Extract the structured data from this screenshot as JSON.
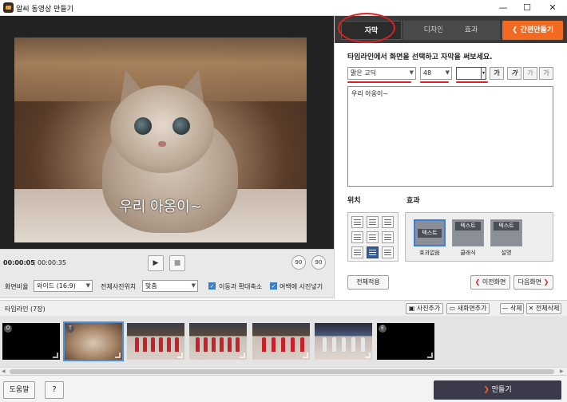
{
  "window": {
    "title": "알씨 동영상 만들기",
    "minimize": "—",
    "maximize": "☐",
    "close": "✕"
  },
  "video": {
    "caption": "우리 아옹이~"
  },
  "controls": {
    "current_time": "00:00:05",
    "total_time": "00:00:35",
    "play": "▶",
    "stop": "■",
    "rotate_left": "90",
    "rotate_right": "90"
  },
  "options": {
    "aspect_label": "화면비율",
    "aspect_value": "와이드 (16:9)",
    "photo_pos_label": "전체사진위치",
    "photo_pos_value": "맞춤",
    "zoom_label": "이동과 확대축소",
    "fill_label": "여백에 사진넣기"
  },
  "tabs": [
    {
      "label": "자막"
    },
    {
      "label": "디자인"
    },
    {
      "label": "효과"
    }
  ],
  "quick_make": "간편만들기",
  "subtitle": {
    "instruction": "타임라인에서 화면을 선택하고 자막을 써보세요.",
    "font": "맑은 고딕",
    "size": "48",
    "bold": "가",
    "italic": "가",
    "underline": "가",
    "shadow": "가",
    "text": "우리 아옹이~"
  },
  "position": {
    "label": "위치"
  },
  "effect": {
    "label": "효과",
    "items": [
      {
        "thumb": "텍스트",
        "label": "효과없음"
      },
      {
        "thumb": "텍스트",
        "label": "클래식"
      },
      {
        "thumb": "텍스트",
        "label": "설명"
      }
    ]
  },
  "buttons": {
    "apply_all": "전체적용",
    "prev_screen": "이전화면",
    "next_screen": "다음화면"
  },
  "timeline": {
    "label": "타임라인",
    "count": "(7장)",
    "add_photo": "사진추가",
    "new_screen": "새화면추가",
    "delete": "삭제",
    "delete_all": "전체삭제",
    "thumbs": [
      {
        "badge": "O"
      },
      {
        "badge": "T"
      },
      {
        "badge": ""
      },
      {
        "badge": ""
      },
      {
        "badge": ""
      },
      {
        "badge": ""
      },
      {
        "badge": "E"
      }
    ]
  },
  "footer": {
    "help": "도움말",
    "question": "?",
    "make": "만들기"
  },
  "colors": {
    "accent_orange": "#f26a22",
    "annotation_red": "#e02020",
    "selection_blue": "#3b7ddd"
  }
}
